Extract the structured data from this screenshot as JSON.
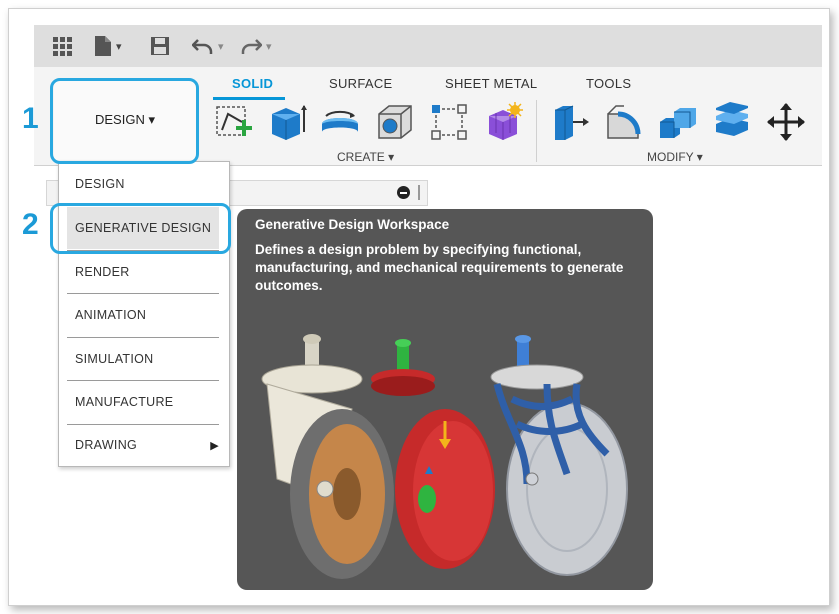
{
  "steps": {
    "one": "1",
    "two": "2"
  },
  "ribbon": {
    "tabs": [
      {
        "label": "SOLID",
        "active": true
      },
      {
        "label": "SURFACE"
      },
      {
        "label": "SHEET METAL"
      },
      {
        "label": "TOOLS"
      }
    ],
    "workspace_button": "DESIGN ▾",
    "groups": {
      "create": "CREATE ▾",
      "modify": "MODIFY ▾"
    }
  },
  "qat": {
    "icons": [
      "grid-icon",
      "file-icon",
      "save-icon",
      "undo-icon",
      "redo-icon"
    ],
    "caret": "▾"
  },
  "menu": {
    "items": [
      {
        "label": "DESIGN"
      },
      {
        "label": "GENERATIVE DESIGN"
      },
      {
        "label": "RENDER"
      },
      {
        "label": "ANIMATION"
      },
      {
        "label": "SIMULATION"
      },
      {
        "label": "MANUFACTURE"
      },
      {
        "label": "DRAWING",
        "submenu_arrow": "▶"
      }
    ]
  },
  "tooltip": {
    "title": "Generative Design Workspace",
    "description": "Defines a design problem by specifying functional, manufacturing, and mechanical requirements to generate outcomes."
  },
  "colors": {
    "accent": "#0696d7",
    "highlight": "#29a8e0",
    "tooltip_bg": "#565656"
  }
}
